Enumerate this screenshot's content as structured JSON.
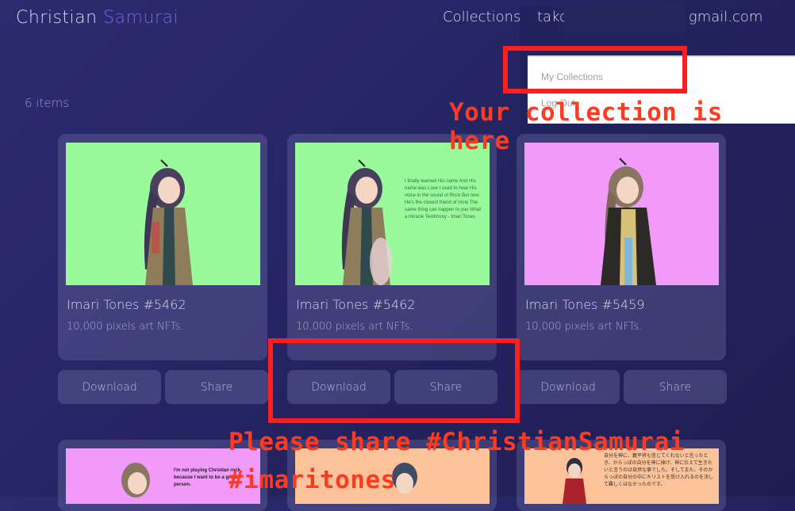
{
  "header": {
    "brand_first": "Christian",
    "brand_second": "Samurai",
    "nav_collections": "Collections",
    "email_prefix": "tako",
    "email_suffix": "gmail.com"
  },
  "dropdown": {
    "items": [
      "My Collections",
      "Log Out"
    ]
  },
  "item_count": "6 items",
  "cards": [
    {
      "title": "Imari Tones #5462",
      "subtitle": "10,000 pixels art NFTs.",
      "bg": "#99fa9c",
      "download": "Download",
      "share": "Share"
    },
    {
      "title": "Imari Tones #5462",
      "subtitle": "10,000 pixels art NFTs.",
      "bg": "#99fa9c",
      "download": "Download",
      "share": "Share"
    },
    {
      "title": "Imari Tones #5459",
      "subtitle": "10,000 pixels art NFTs.",
      "bg": "#f19afa",
      "download": "Download",
      "share": "Share"
    }
  ],
  "poem": "I finally learned His name And His name was Love I used to hear His voice in the sound of Rock But now He's the closest friend of mine The same thing can happen to you What a miracle Testimony - Imari Tones",
  "bottom_cards": [
    {
      "bg": "#f19afa",
      "text": "I'm not playing Christian rock because I want to be a great person."
    },
    {
      "bg": "#fcc39a",
      "text": ""
    },
    {
      "bg": "#fcc39a",
      "text": "自分を神に、義平将も信じてくれないと言ったとき、からっぽの自分を神に捧げ、神に仕えて生きたいと言うのは自然な事でした。そしてまた、そのからっぽの自分の中にキリストを受け入れるのを決して難しくはなかったのです。"
    }
  ],
  "annotations": {
    "collection_here": "Your collection is here",
    "share_line1": "Please share #ChristianSamurai",
    "share_line2": "#imaritones"
  },
  "colors": {
    "accent": "#7a63e0",
    "annotation_red": "#ff1e1e"
  }
}
